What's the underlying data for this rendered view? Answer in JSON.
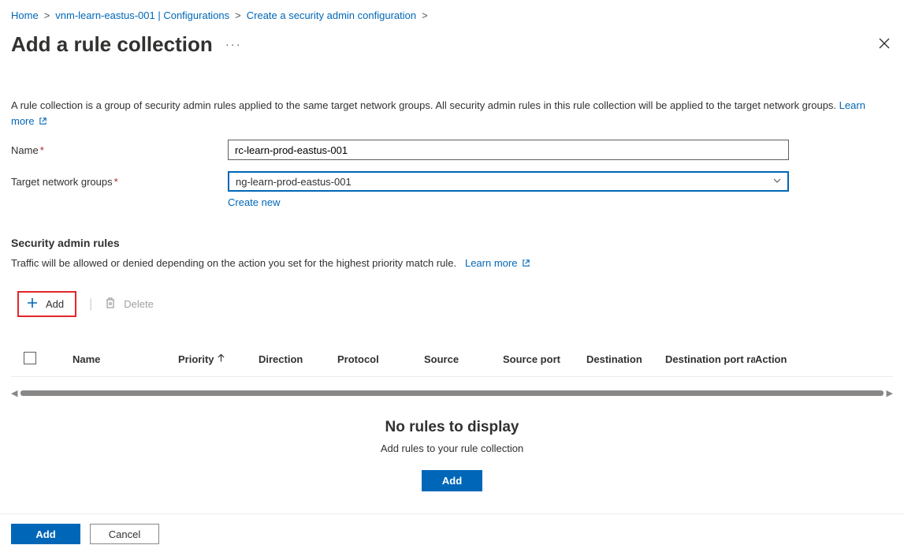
{
  "breadcrumb": {
    "home": "Home",
    "item1": "vnm-learn-eastus-001 | Configurations",
    "item2": "Create a security admin configuration"
  },
  "title": "Add a rule collection",
  "description": {
    "text": "A rule collection is a group of security admin rules applied to the same target network groups. All security admin rules in this rule collection will be applied to the target network groups.",
    "learn_more": "Learn more"
  },
  "form": {
    "name_label": "Name",
    "name_value": "rc-learn-prod-eastus-001",
    "target_label": "Target network groups",
    "target_value": "ng-learn-prod-eastus-001",
    "create_new": "Create new"
  },
  "rules": {
    "heading": "Security admin rules",
    "subtext": "Traffic will be allowed or denied depending on the action you set for the highest priority match rule.",
    "learn_more": "Learn more",
    "toolbar_add": "Add",
    "toolbar_delete": "Delete",
    "columns": {
      "name": "Name",
      "priority": "Priority",
      "direction": "Direction",
      "protocol": "Protocol",
      "source": "Source",
      "source_port": "Source port",
      "destination": "Destination",
      "dest_ranges": "Destination port ranges",
      "action": "Action"
    },
    "empty_title": "No rules to display",
    "empty_sub": "Add rules to your rule collection",
    "empty_btn": "Add"
  },
  "footer": {
    "add": "Add",
    "cancel": "Cancel"
  }
}
